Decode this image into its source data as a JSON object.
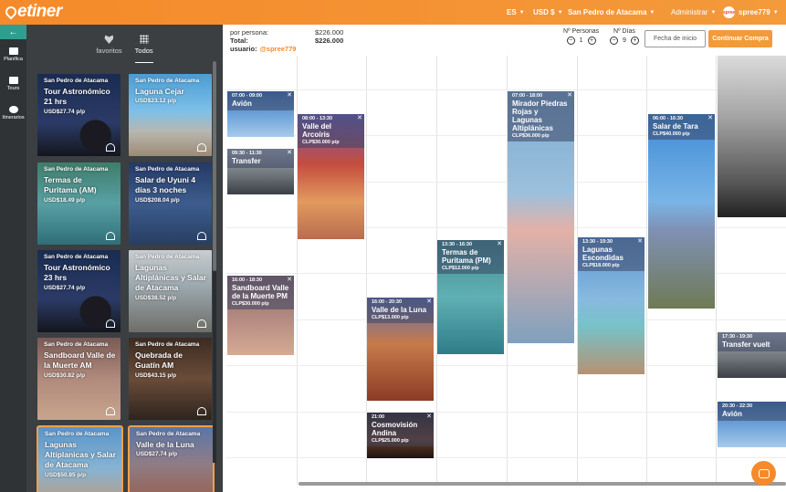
{
  "header": {
    "logo": "etiner",
    "lang": "ES",
    "currency": "USD $",
    "location": "San Pedro de Atacama",
    "admin": "Administrar",
    "avatar_text": "spree",
    "username": "spree779"
  },
  "rail": {
    "items": [
      {
        "label": "Planifica"
      },
      {
        "label": "Tours"
      },
      {
        "label": "Itinerarios"
      }
    ]
  },
  "panel": {
    "tab_favorites": "favoritos",
    "tab_all": "Todos",
    "cards": [
      {
        "location": "San Pedro de Atacama",
        "title": "Tour Astronómico 21 hrs",
        "price": "USD$27.74 p/p"
      },
      {
        "location": "San Pedro de Atacama",
        "title": "Laguna Cejar",
        "price": "USD$23.12 p/p"
      },
      {
        "location": "San Pedro de Atacama",
        "title": "Termas de Puritama (AM)",
        "price": "USD$18.49 p/p"
      },
      {
        "location": "San Pedro de Atacama",
        "title": "Salar de Uyuni 4 días 3 noches",
        "price": "USD$208.04 p/p"
      },
      {
        "location": "San Pedro de Atacama",
        "title": "Tour Astronómico 23 hrs",
        "price": "USD$27.74 p/p"
      },
      {
        "location": "San Pedro de Atacama",
        "title": "Lagunas Altiplánicas y Salar de Atacama",
        "price": "USD$38.52 p/p"
      },
      {
        "location": "San Pedro de Atacama",
        "title": "Sandboard Valle de la Muerte AM",
        "price": "USD$30.82 p/p"
      },
      {
        "location": "San Pedro de Atacama",
        "title": "Quebrada de Guatín AM",
        "price": "USD$43.15 p/p"
      },
      {
        "location": "San Pedro de Atacama",
        "title": "Lagunas Altiplanicas y Salar de Atacama",
        "price": "USD$50.85 p/p"
      },
      {
        "location": "San Pedro de Atacama",
        "title": "Valle de la Luna",
        "price": "USD$27.74 p/p"
      }
    ]
  },
  "summary": {
    "per_person_label": "por persona:",
    "per_person_value": "$226.000",
    "total_label": "Total:",
    "total_value": "$226.000",
    "user_label": "usuario:",
    "user_value": "@spree779"
  },
  "controls": {
    "persons_label": "Nº Personas",
    "persons_value": "1",
    "days_label": "Nº Días",
    "days_value": "9",
    "minus": "−",
    "plus": "+",
    "date_button": "Fecha de inicio",
    "buy_button": "Continuar Compra"
  },
  "events": [
    {
      "time": "07:00 - 09:00",
      "name": "Avión",
      "cost": ""
    },
    {
      "time": "09:30 - 11:30",
      "name": "Transfer",
      "cost": ""
    },
    {
      "time": "16:00 - 18:30",
      "name": "Sandboard Valle de la Muerte PM",
      "cost": "CLP$30.000 p/p"
    },
    {
      "time": "08:00 - 13:30",
      "name": "Valle del Arcoíris",
      "cost": "CLP$30.000 p/p"
    },
    {
      "time": "16:00 - 20:30",
      "name": "Valle de la Luna",
      "cost": "CLP$13.000 p/p"
    },
    {
      "time": "21:00",
      "name": "Cosmovisión Andina",
      "cost": "CLP$25.000 p/p"
    },
    {
      "time": "13:30 - 16:30",
      "name": "Termas de Puritama (PM)",
      "cost": "CLP$12.000 p/p"
    },
    {
      "time": "07:00 - 18:00",
      "name": "Mirador Piedras Rojas y Lagunas Altiplánicas",
      "cost": "CLP$36.000 p/p"
    },
    {
      "time": "13:30 - 19:30",
      "name": "Lagunas Escondidas",
      "cost": "CLP$18.000 p/p"
    },
    {
      "time": "06:00 - 16:30",
      "name": "Salar de Tara",
      "cost": "CLP$40.000 p/p"
    },
    {
      "time": "17:30 - 19:30",
      "name": "Transfer vuelt",
      "cost": ""
    },
    {
      "time": "20:30 - 22:30",
      "name": "Avión",
      "cost": ""
    }
  ],
  "colors": {
    "brand": "#f58a2a",
    "teal": "#2f9e8f",
    "sidebar": "#2f3336",
    "panel": "#3b3f42"
  }
}
